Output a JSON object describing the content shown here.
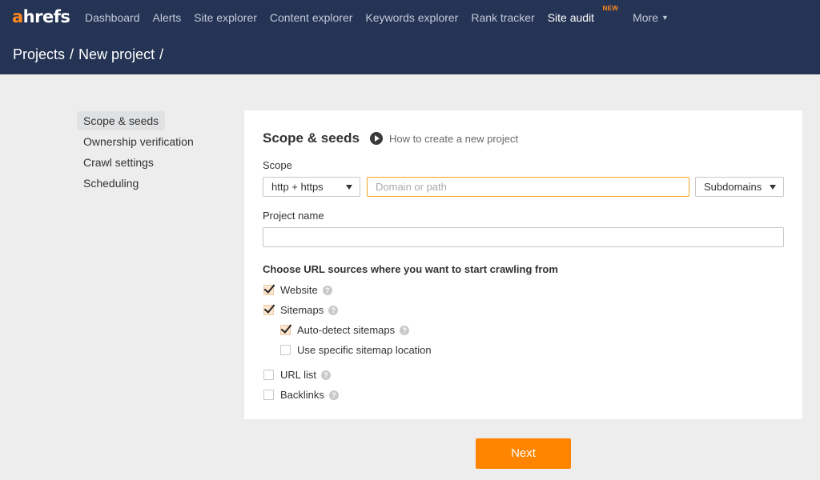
{
  "nav": {
    "logo_a": "a",
    "logo_rest": "hrefs",
    "links": [
      "Dashboard",
      "Alerts",
      "Site explorer",
      "Content explorer",
      "Keywords explorer",
      "Rank tracker",
      "Site audit"
    ],
    "new_badge": "NEW",
    "more": "More"
  },
  "breadcrumb": {
    "item1": "Projects",
    "sep": "/",
    "item2": "New project"
  },
  "sidebar": {
    "items": [
      "Scope & seeds",
      "Ownership verification",
      "Crawl settings",
      "Scheduling"
    ]
  },
  "card": {
    "title": "Scope & seeds",
    "howto": "How to create a new project",
    "scope_label": "Scope",
    "protocol": "http + https",
    "domain_placeholder": "Domain or path",
    "domain_value": "",
    "subdomains": "Subdomains",
    "project_name_label": "Project name",
    "project_name_value": "",
    "sources_title": "Choose URL sources where you want to start crawling from",
    "sources": [
      {
        "label": "Website",
        "checked": true,
        "help": true
      },
      {
        "label": "Sitemaps",
        "checked": true,
        "help": true
      },
      {
        "label": "Auto-detect sitemaps",
        "checked": true,
        "help": true
      },
      {
        "label": "Use specific sitemap location",
        "checked": false,
        "help": false
      },
      {
        "label": "URL list",
        "checked": false,
        "help": true
      },
      {
        "label": "Backlinks",
        "checked": false,
        "help": true
      }
    ]
  },
  "next_button": "Next",
  "colors": {
    "nav_bg": "#253354",
    "accent": "#ff8400",
    "logo_accent": "#ff8a1e"
  },
  "icons": {
    "play": "play-circle-icon",
    "help": "question-circle-icon",
    "caret": "caret-down-icon"
  }
}
